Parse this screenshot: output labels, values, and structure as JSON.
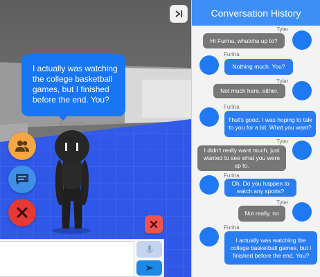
{
  "scene": {
    "speech_text": "I actually was watching the college basketball games, but I finished before the end. You?",
    "character_name": "Furina",
    "buttons": {
      "users_icon": "users-icon",
      "chat_icon": "chat-icon",
      "close_icon": "close-icon"
    },
    "input": {
      "value": "",
      "placeholder": ""
    },
    "colors": {
      "sky": "#6a6a6a",
      "floor": "#2f57e8",
      "accent": "#1976f2"
    }
  },
  "history": {
    "title": "Conversation History",
    "messages": [
      {
        "speaker": "Tyler",
        "text": "Hi Furina, whatcha up to?"
      },
      {
        "speaker": "Furina",
        "text": "Nothing much. You?"
      },
      {
        "speaker": "Tyler",
        "text": "Not much here, either."
      },
      {
        "speaker": "Furina",
        "text": "That's good. I was hoping to talk to you for a bit. What you want?"
      },
      {
        "speaker": "Tyler",
        "text": "I didn't really want much, just wanted to see what you were up to."
      },
      {
        "speaker": "Furina",
        "text": "Oh. Do you happen to watch any sports?"
      },
      {
        "speaker": "Tyler",
        "text": "Not really, no"
      },
      {
        "speaker": "Furina",
        "text": "I actually was watching the college basketball games, but I finished before the end. You?"
      }
    ]
  }
}
